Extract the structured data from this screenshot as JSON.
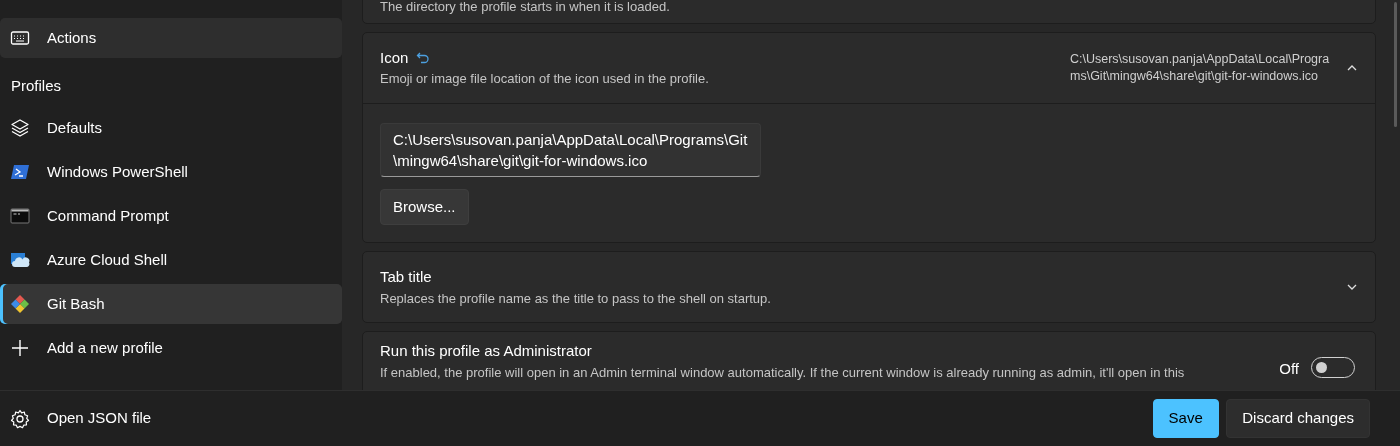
{
  "sidebar": {
    "items": [
      {
        "kind": "item",
        "label": "Actions",
        "selected": false,
        "hovered": true
      },
      {
        "kind": "header",
        "label": "Profiles"
      },
      {
        "kind": "item",
        "label": "Defaults",
        "selected": false,
        "hovered": false
      },
      {
        "kind": "item",
        "label": "Windows PowerShell",
        "selected": false,
        "hovered": false
      },
      {
        "kind": "item",
        "label": "Command Prompt",
        "selected": false,
        "hovered": false
      },
      {
        "kind": "item",
        "label": "Azure Cloud Shell",
        "selected": false,
        "hovered": false
      },
      {
        "kind": "item",
        "label": "Git Bash",
        "selected": true,
        "hovered": false
      },
      {
        "kind": "item",
        "label": "Add a new profile",
        "selected": false,
        "hovered": false
      }
    ],
    "footer_item": {
      "label": "Open JSON file"
    }
  },
  "cards": [
    {
      "kind": "partial",
      "description": "The directory the profile starts in when it is loaded."
    },
    {
      "kind": "expander",
      "title": "Icon",
      "reset": true,
      "description": "Emoji or image file location of the icon used in the profile.",
      "value": "C:\\Users\\susovan.panja\\AppData\\Local\\Programs\\Git\\mingw64\\share\\git\\git-for-windows.ico",
      "expanded": true,
      "input_value": "C:\\Users\\susovan.panja\\AppData\\Local\\Programs\\Git\\mingw64\\share\\git\\git-for-windows.ico",
      "button": "Browse..."
    },
    {
      "kind": "expander",
      "title": "Tab title",
      "description": "Replaces the profile name as the title to pass to the shell on startup.",
      "expanded": false
    },
    {
      "kind": "toggle",
      "title": "Run this profile as Administrator",
      "description": "If enabled, the profile will open in an Admin terminal window automatically. If the current window is already running as admin, it'll open in this",
      "on": false,
      "state_label": "Off"
    }
  ],
  "footer": {
    "buttons": [
      {
        "label": "Save",
        "primary": true
      },
      {
        "label": "Discard changes",
        "primary": false
      }
    ]
  }
}
